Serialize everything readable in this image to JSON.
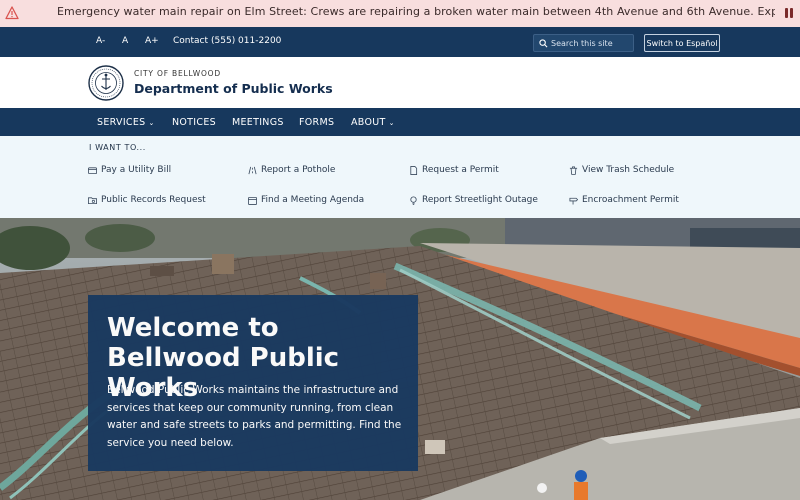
{
  "alert": {
    "message": "Emergency water main repair on Elm Street: Crews are repairing a broken water main between 4th Avenue and 6th Avenue. Expect low water pressure in the surrounding area.",
    "warn_icon": "warning-triangle-icon",
    "pause_icon": "pause-icon",
    "colors": {
      "background": "#f8dede",
      "icon": "#d9534f"
    }
  },
  "utility": {
    "text_small": "A-",
    "text_normal": "A",
    "text_large": "A+",
    "contact_label": "Contact",
    "phone": "(555) 011-2200",
    "search_placeholder": "Search this site",
    "language_button": "Switch to Español"
  },
  "header": {
    "kicker": "CITY OF BELLWOOD",
    "department": "Department of Public Works"
  },
  "nav": {
    "items": [
      {
        "label": "SERVICES",
        "has_menu": true
      },
      {
        "label": "NOTICES",
        "has_menu": false
      },
      {
        "label": "MEETINGS",
        "has_menu": false
      },
      {
        "label": "FORMS",
        "has_menu": false
      },
      {
        "label": "ABOUT",
        "has_menu": true
      }
    ],
    "chevron": "⌄"
  },
  "quick_links": {
    "title": "I WANT TO...",
    "items": [
      {
        "label": "Pay a Utility Bill",
        "icon": "credit-card-icon"
      },
      {
        "label": "Report a Pothole",
        "icon": "road-icon"
      },
      {
        "label": "Request a Permit",
        "icon": "document-icon"
      },
      {
        "label": "View Trash Schedule",
        "icon": "trash-icon"
      },
      {
        "label": "Public Records Request",
        "icon": "folder-search-icon"
      },
      {
        "label": "Find a Meeting Agenda",
        "icon": "calendar-icon"
      },
      {
        "label": "Report Streetlight Outage",
        "icon": "lightbulb-icon"
      },
      {
        "label": "Encroachment Permit",
        "icon": "signpost-icon"
      }
    ]
  },
  "hero": {
    "heading": "Welcome to Bellwood Public Works",
    "body": "Bellwood Public Works maintains the infrastructure and services that keep our community running, from clean water and safe streets to parks and permitting. Find the service you need below."
  },
  "colors": {
    "navy": "#17385d",
    "header_text": "#152e4f",
    "quick_bg": "#eff7fb"
  }
}
